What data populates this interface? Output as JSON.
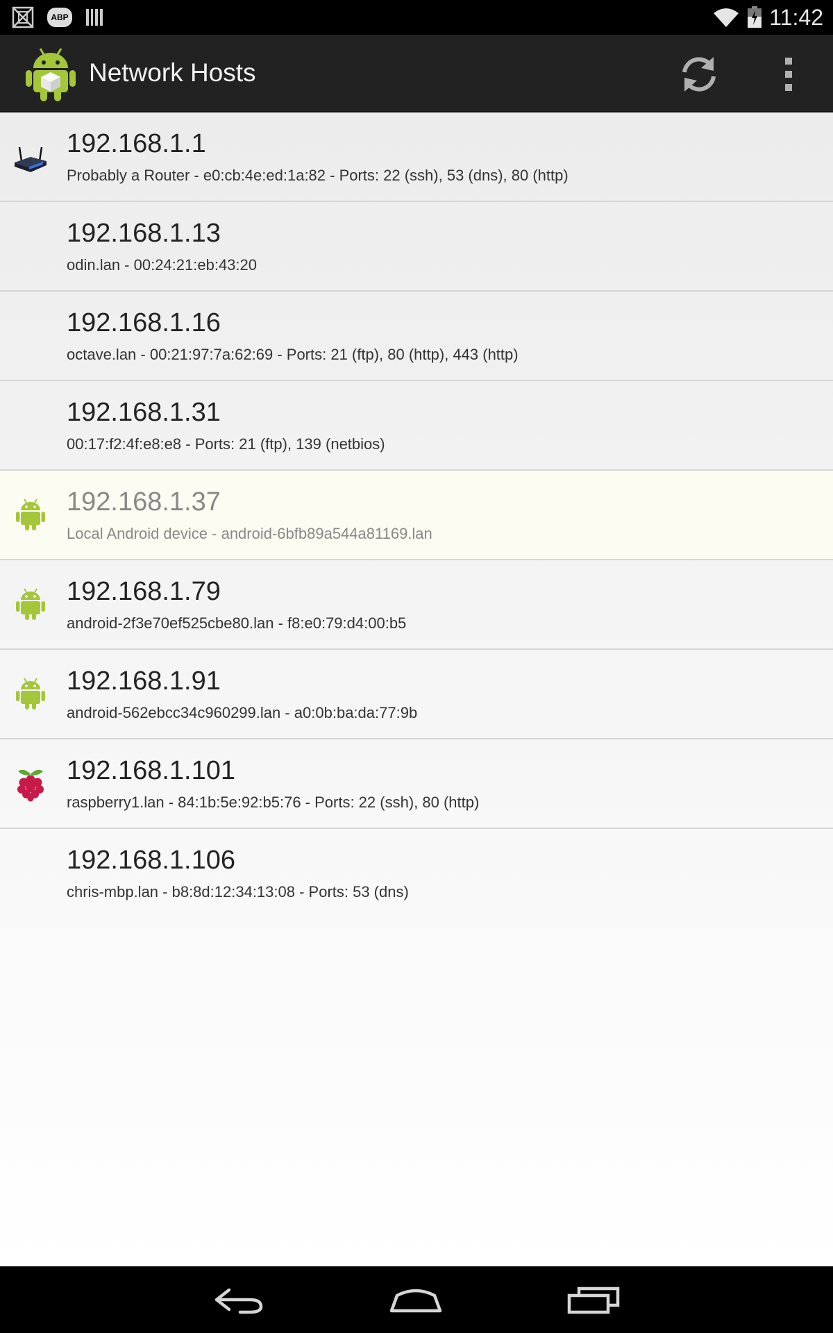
{
  "status_bar": {
    "clock": "11:42",
    "abp_label": "ABP",
    "icons": [
      "no-sim-icon",
      "adblock-plus-icon",
      "barcode-icon",
      "wifi-icon",
      "battery-icon"
    ]
  },
  "action_bar": {
    "title": "Network Hosts",
    "icons": [
      "android-app-icon",
      "refresh-icon",
      "overflow-menu-icon"
    ]
  },
  "hosts": [
    {
      "ip": "192.168.1.1",
      "detail": "Probably a Router - e0:cb:4e:ed:1a:82 - Ports: 22 (ssh), 53 (dns), 80 (http)",
      "icon": "router-icon"
    },
    {
      "ip": "192.168.1.13",
      "detail": "odin.lan - 00:24:21:eb:43:20",
      "icon": ""
    },
    {
      "ip": "192.168.1.16",
      "detail": "octave.lan - 00:21:97:7a:62:69 - Ports: 21 (ftp), 80 (http), 443 (http)",
      "icon": ""
    },
    {
      "ip": "192.168.1.31",
      "detail": "00:17:f2:4f:e8:e8 - Ports: 21 (ftp), 139 (netbios)",
      "icon": ""
    },
    {
      "ip": "192.168.1.37",
      "detail": "Local Android device - android-6bfb89a544a81169.lan",
      "icon": "android-icon"
    },
    {
      "ip": "192.168.1.79",
      "detail": "android-2f3e70ef525cbe80.lan - f8:e0:79:d4:00:b5",
      "icon": "android-icon"
    },
    {
      "ip": "192.168.1.91",
      "detail": "android-562ebcc34c960299.lan - a0:0b:ba:da:77:9b",
      "icon": "android-icon"
    },
    {
      "ip": "192.168.1.101",
      "detail": "raspberry1.lan - 84:1b:5e:92:b5:76 - Ports: 22 (ssh), 80 (http)",
      "icon": "raspberry-pi-icon"
    },
    {
      "ip": "192.168.1.106",
      "detail": "chris-mbp.lan - b8:8d:12:34:13:08 - Ports: 53 (dns)",
      "icon": ""
    }
  ],
  "nav_bar": {
    "icons": [
      "back-icon",
      "home-icon",
      "recents-icon"
    ]
  },
  "colors": {
    "android_green": "#a4c639",
    "action_bar_bg": "#222222",
    "highlight_row_bg": "#fcfcf2"
  }
}
